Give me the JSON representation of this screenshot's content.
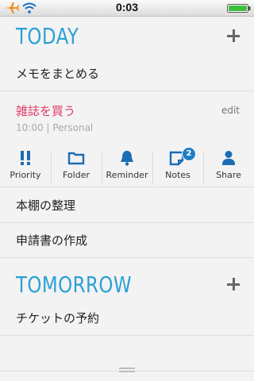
{
  "status_bar": {
    "time": "0:03"
  },
  "today": {
    "title": "TODAY",
    "items": [
      {
        "text": "メモをまとめる"
      }
    ],
    "expanded": {
      "title": "雑誌を買う",
      "edit_label": "edit",
      "subtitle": "10:00 | Personal"
    },
    "toolbar": [
      {
        "label": "Priority",
        "icon": "priority-icon"
      },
      {
        "label": "Folder",
        "icon": "folder-icon"
      },
      {
        "label": "Reminder",
        "icon": "bell-icon"
      },
      {
        "label": "Notes",
        "icon": "notes-icon",
        "badge": "2"
      },
      {
        "label": "Share",
        "icon": "person-icon"
      }
    ],
    "more_items": [
      {
        "text": "本棚の整理"
      },
      {
        "text": "申請書の作成"
      }
    ]
  },
  "tomorrow": {
    "title": "TOMORROW",
    "items": [
      {
        "text": "チケットの予約"
      }
    ]
  },
  "colors": {
    "accent": "#2aa0d6",
    "highlight": "#e23c6b",
    "badge": "#1e7fc3"
  }
}
